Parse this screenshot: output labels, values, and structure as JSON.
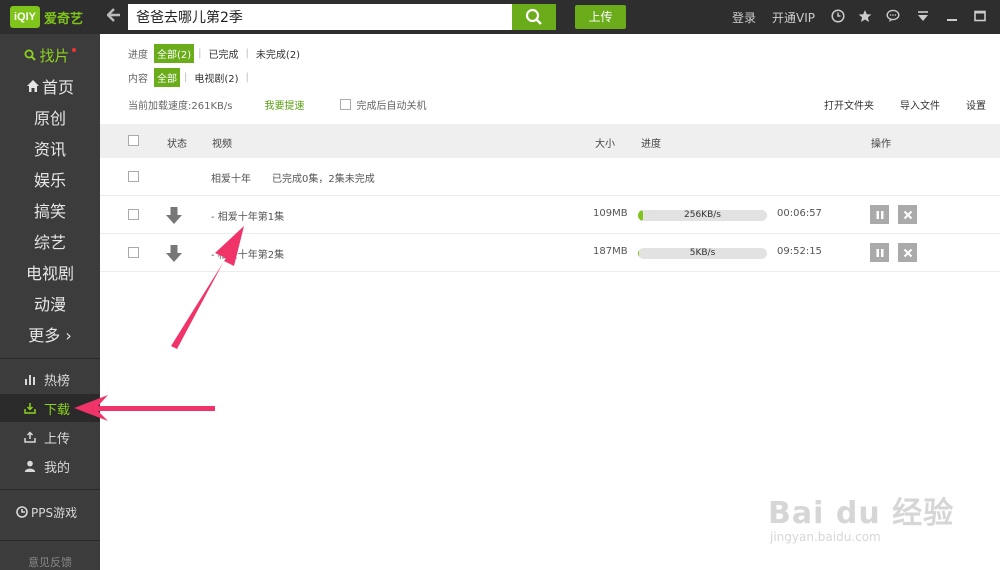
{
  "app": {
    "logo_box": "iQIY",
    "logo_text": "爱奇艺"
  },
  "topbar": {
    "search_value": "爸爸去哪儿第2季",
    "upload_label": "上传",
    "login_label": "登录",
    "vip_label": "开通VIP"
  },
  "sidebar": {
    "find_label": "找片",
    "nav": [
      "首页",
      "原创",
      "资讯",
      "娱乐",
      "搞笑",
      "综艺",
      "电视剧",
      "动漫",
      "更多 ›"
    ],
    "sub": [
      {
        "label": "热榜",
        "icon": "chart-bars-icon"
      },
      {
        "label": "下载",
        "icon": "download-icon",
        "active": true
      },
      {
        "label": "上传",
        "icon": "upload-icon"
      },
      {
        "label": "我的",
        "icon": "user-icon"
      }
    ],
    "pps_label": "PPS游戏",
    "feedback_label": "意见反馈"
  },
  "filters": {
    "progress_label": "进度",
    "progress_options": [
      "全部(2)",
      "已完成",
      "未完成(2)"
    ],
    "content_label": "内容",
    "content_options": [
      "全部",
      "电视剧(2)"
    ],
    "speed_text": "当前加载速度:261KB/s",
    "accelerate_label": "我要提速",
    "auto_shutdown_label": "完成后自动关机",
    "open_folder_label": "打开文件夹",
    "import_label": "导入文件",
    "settings_label": "设置"
  },
  "table": {
    "headers": {
      "status": "状态",
      "video": "视频",
      "size": "大小",
      "progress": "进度",
      "action": "操作"
    },
    "group": {
      "title": "相爱十年",
      "summary": "已完成0集，2集未完成"
    },
    "rows": [
      {
        "title": "- 相爱十年第1集",
        "size": "109MB",
        "speed": "256KB/s",
        "time": "00:06:57",
        "progress": 0.04
      },
      {
        "title": "- 相爱十年第2集",
        "size": "187MB",
        "speed": "5KB/s",
        "time": "09:52:15",
        "progress": 0.01
      }
    ]
  },
  "watermark": {
    "main": "Bai du 经验",
    "sub": "jingyan.baidu.com"
  },
  "colors": {
    "accent": "#6aac1a",
    "sidebar_bg": "#3c3c3c",
    "topbar_bg": "#2e2e2e",
    "annotation_arrow": "#f0346a"
  }
}
